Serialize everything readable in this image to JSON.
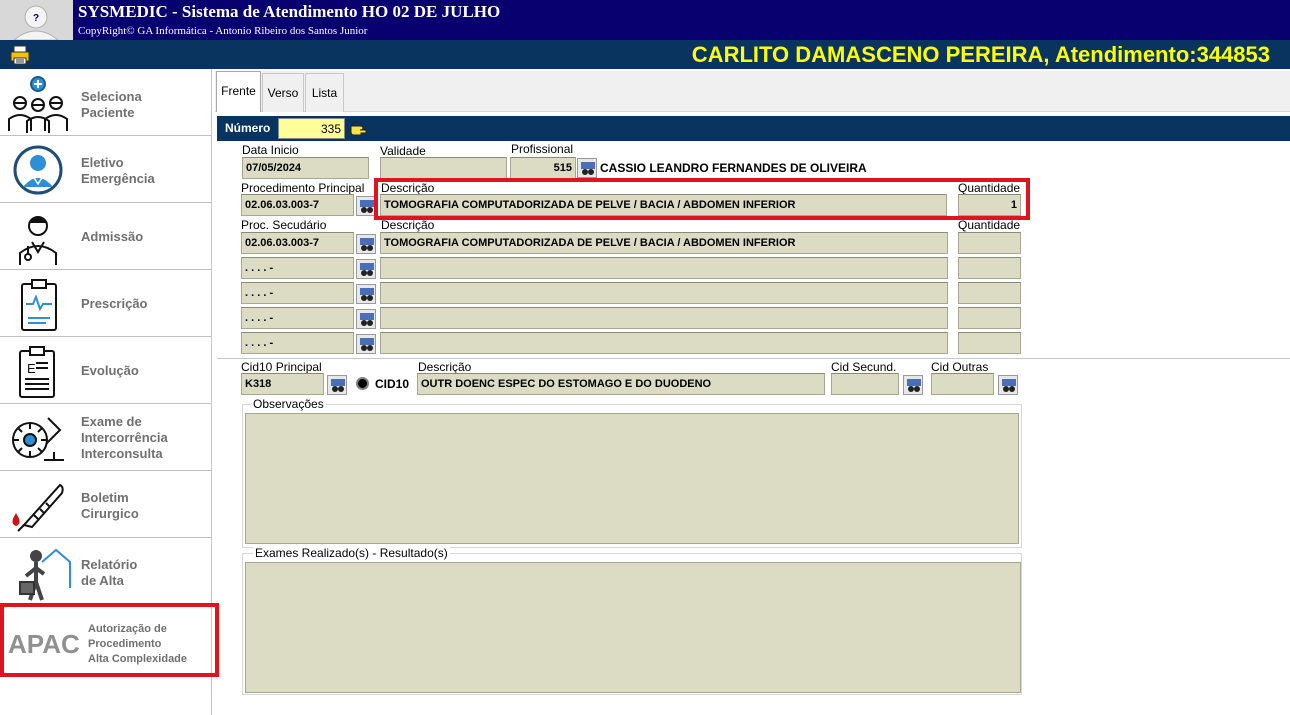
{
  "window": {
    "title": "SYSMEDIC - Sistema de Atendimento HO 02 DE JULHO",
    "copyright": "CopyRight© GA Informática - Antonio Ribeiro dos Santos Junior"
  },
  "patient_bar": {
    "text": "CARLITO DAMASCENO PEREIRA, Atendimento:344853"
  },
  "sidebar": {
    "items": [
      {
        "label": "Seleciona\nPaciente",
        "icon": "patients-icon"
      },
      {
        "label": "Eletivo\nEmergência",
        "icon": "doctor-icon"
      },
      {
        "label": "Admissão",
        "icon": "admission-icon"
      },
      {
        "label": "Prescrição",
        "icon": "clipboard-pulse-icon"
      },
      {
        "label": "Evolução",
        "icon": "clipboard-chart-icon"
      },
      {
        "label": "Exame de\nIntercorrência\nInterconsulta",
        "icon": "lab-exam-icon"
      },
      {
        "label": "Boletim\nCirurgico",
        "icon": "scalpel-icon"
      },
      {
        "label": "Relatório\nde Alta",
        "icon": "discharge-icon"
      }
    ],
    "apac": {
      "logo": "APAC",
      "label": "Autorização de\nProcedimento\nAlta Complexidade"
    }
  },
  "tabs": [
    "Frente",
    "Verso",
    "Lista"
  ],
  "numero": {
    "label": "Número",
    "value": "335"
  },
  "form": {
    "data_inicio": {
      "label": "Data Inicio",
      "value": "07/05/2024"
    },
    "validade": {
      "label": "Validade",
      "value": ""
    },
    "profissional": {
      "label": "Profissional",
      "code": "515",
      "name": "CASSIO LEANDRO FERNANDES DE OLIVEIRA"
    },
    "proc_principal": {
      "label": "Procedimento Principal",
      "code": "02.06.03.003-7",
      "desc_label": "Descrição",
      "desc": "TOMOGRAFIA COMPUTADORIZADA DE PELVE / BACIA / ABDOMEN INFERIOR",
      "qty_label": "Quantidade",
      "qty": "1"
    },
    "proc_secundario": {
      "label": "Proc. Secudário",
      "desc_label": "Descrição",
      "qty_label": "Quantidade",
      "rows": [
        {
          "code": "02.06.03.003-7",
          "desc": "TOMOGRAFIA COMPUTADORIZADA DE PELVE / BACIA / ABDOMEN INFERIOR",
          "qty": ""
        },
        {
          "code": " . . .  . -",
          "desc": "",
          "qty": ""
        },
        {
          "code": " . . .  . -",
          "desc": "",
          "qty": ""
        },
        {
          "code": " . . .  . -",
          "desc": "",
          "qty": ""
        },
        {
          "code": " . . .  . -",
          "desc": "",
          "qty": ""
        }
      ]
    },
    "cid10": {
      "label": "Cid10 Principal",
      "code": "K318",
      "radio_label": "CID10",
      "desc_label": "Descrição",
      "desc": "OUTR DOENC ESPEC DO ESTOMAGO E DO DUODENO",
      "secund_label": "Cid Secund.",
      "secund": "",
      "outras_label": "Cid Outras",
      "outras": ""
    },
    "observacoes": {
      "label": "Observações",
      "value": ""
    },
    "exames": {
      "label": "Exames Realizado(s) - Resultado(s)",
      "value": ""
    }
  },
  "colors": {
    "title_bg": "#08006e",
    "bar_bg": "#08345f",
    "patient_text": "#ffff00",
    "field_bg": "#dcdcc4",
    "highlight": "#e0141e"
  }
}
